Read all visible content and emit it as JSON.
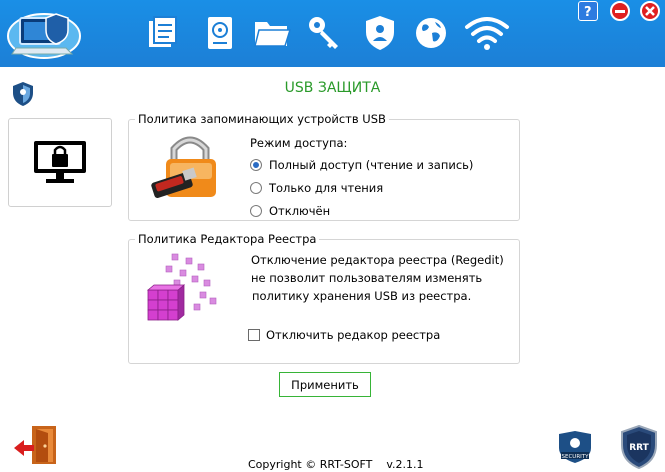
{
  "page_title": "USB ЗАЩИТА",
  "usb_policy": {
    "legend": "Политика запоминающих устройств USB",
    "access_label": "Режим доступа:",
    "options": [
      {
        "label": "Полный доступ (чтение и запись)",
        "selected": true
      },
      {
        "label": "Только для чтения",
        "selected": false
      },
      {
        "label": "Отключён",
        "selected": false
      }
    ]
  },
  "registry_policy": {
    "legend": "Политика Редактора Реестра",
    "description_lines": [
      "Отключение редактора реестра (Regedit)",
      "не позволит пользователям изменять",
      "политику хранения USB из реестра."
    ],
    "checkbox_label": "Отключить редакор реестра",
    "checkbox_checked": false
  },
  "apply_label": "Применить",
  "footer": {
    "copyright": "Copyright © RRT-SOFT",
    "version": "v.2.1.1"
  },
  "logo_badges": {
    "security": "SECURITY",
    "rrt": "RRT"
  },
  "nav_icons": [
    "files-icon",
    "disk-icon",
    "folder-icon",
    "keys-icon",
    "shield-icon",
    "globe-icon",
    "wifi-icon"
  ],
  "colors": {
    "topbar": "#1a8fe6",
    "title": "#2a9a2a",
    "apply_border": "#37b437"
  }
}
